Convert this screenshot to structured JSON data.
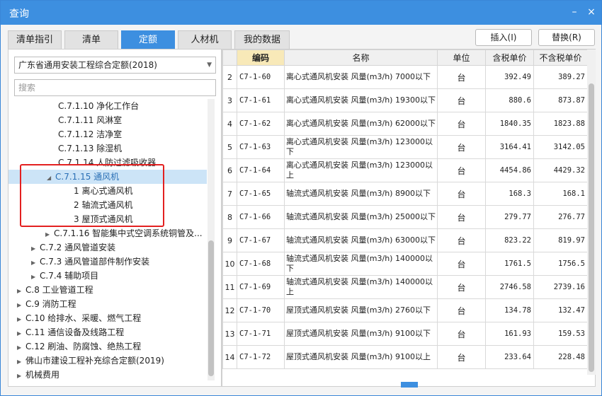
{
  "window": {
    "title": "查询",
    "min_icon": "–",
    "close_icon": "×"
  },
  "tabs": [
    "清单指引",
    "清单",
    "定额",
    "人材机",
    "我的数据"
  ],
  "buttons": {
    "insert": "插入(I)",
    "replace": "替换(R)"
  },
  "left": {
    "dropdown": "广东省通用安装工程综合定额(2018)",
    "search_placeholder": "搜索",
    "tree": [
      {
        "label": "C.7.1.10 净化工作台",
        "expand": ""
      },
      {
        "label": "C.7.1.11 风淋室",
        "expand": ""
      },
      {
        "label": "C.7.1.12 洁净室",
        "expand": ""
      },
      {
        "label": "C.7.1.13 除湿机",
        "expand": ""
      },
      {
        "label": "C.7.1.14 人防过滤吸收器",
        "expand": ""
      },
      {
        "label": "C.7.1.15 通风机",
        "expand": "◢"
      },
      {
        "label": "1 离心式通风机",
        "expand": ""
      },
      {
        "label": "2 轴流式通风机",
        "expand": ""
      },
      {
        "label": "3 屋顶式通风机",
        "expand": ""
      },
      {
        "label": "C.7.1.16 智能集中式空调系统铜管及...",
        "expand": "▶"
      },
      {
        "label": "C.7.2 通风管道安装",
        "expand": "▶"
      },
      {
        "label": "C.7.3 通风管道部件制作安装",
        "expand": "▶"
      },
      {
        "label": "C.7.4 辅助项目",
        "expand": "▶"
      },
      {
        "label": "C.8 工业管道工程",
        "expand": "▶"
      },
      {
        "label": "C.9 消防工程",
        "expand": "▶"
      },
      {
        "label": "C.10 给排水、采暖、燃气工程",
        "expand": "▶"
      },
      {
        "label": "C.11 通信设备及线路工程",
        "expand": "▶"
      },
      {
        "label": "C.12 刷油、防腐蚀、绝热工程",
        "expand": "▶"
      },
      {
        "label": "佛山市建设工程补充综合定额(2019)",
        "expand": "▶"
      },
      {
        "label": "机械费用",
        "expand": "▶"
      }
    ]
  },
  "table": {
    "headers": [
      "编码",
      "名称",
      "单位",
      "含税单价",
      "不含税单价"
    ],
    "rows": [
      {
        "idx": "2",
        "code": "C7-1-60",
        "name": "离心式通风机安装 风量(m3/h) 7000以下",
        "unit": "台",
        "tax": "392.49",
        "notax": "389.27"
      },
      {
        "idx": "3",
        "code": "C7-1-61",
        "name": "离心式通风机安装 风量(m3/h) 19300以下",
        "unit": "台",
        "tax": "880.6",
        "notax": "873.87"
      },
      {
        "idx": "4",
        "code": "C7-1-62",
        "name": "离心式通风机安装 风量(m3/h) 62000以下",
        "unit": "台",
        "tax": "1840.35",
        "notax": "1823.88"
      },
      {
        "idx": "5",
        "code": "C7-1-63",
        "name": "离心式通风机安装 风量(m3/h) 123000以下",
        "unit": "台",
        "tax": "3164.41",
        "notax": "3142.05"
      },
      {
        "idx": "6",
        "code": "C7-1-64",
        "name": "离心式通风机安装 风量(m3/h) 123000以上",
        "unit": "台",
        "tax": "4454.86",
        "notax": "4429.32"
      },
      {
        "idx": "7",
        "code": "C7-1-65",
        "name": "轴流式通风机安装 风量(m3/h) 8900以下",
        "unit": "台",
        "tax": "168.3",
        "notax": "168.1"
      },
      {
        "idx": "8",
        "code": "C7-1-66",
        "name": "轴流式通风机安装 风量(m3/h) 25000以下",
        "unit": "台",
        "tax": "279.77",
        "notax": "276.77"
      },
      {
        "idx": "9",
        "code": "C7-1-67",
        "name": "轴流式通风机安装 风量(m3/h) 63000以下",
        "unit": "台",
        "tax": "823.22",
        "notax": "819.97"
      },
      {
        "idx": "10",
        "code": "C7-1-68",
        "name": "轴流式通风机安装 风量(m3/h) 140000以下",
        "unit": "台",
        "tax": "1761.5",
        "notax": "1756.5"
      },
      {
        "idx": "11",
        "code": "C7-1-69",
        "name": "轴流式通风机安装 风量(m3/h) 140000以上",
        "unit": "台",
        "tax": "2746.58",
        "notax": "2739.16"
      },
      {
        "idx": "12",
        "code": "C7-1-70",
        "name": "屋顶式通风机安装 风量(m3/h) 2760以下",
        "unit": "台",
        "tax": "134.78",
        "notax": "132.47"
      },
      {
        "idx": "13",
        "code": "C7-1-71",
        "name": "屋顶式通风机安装 风量(m3/h) 9100以下",
        "unit": "台",
        "tax": "161.93",
        "notax": "159.53"
      },
      {
        "idx": "14",
        "code": "C7-1-72",
        "name": "屋顶式通风机安装 风量(m3/h) 9100以上",
        "unit": "台",
        "tax": "233.64",
        "notax": "228.48"
      }
    ]
  }
}
